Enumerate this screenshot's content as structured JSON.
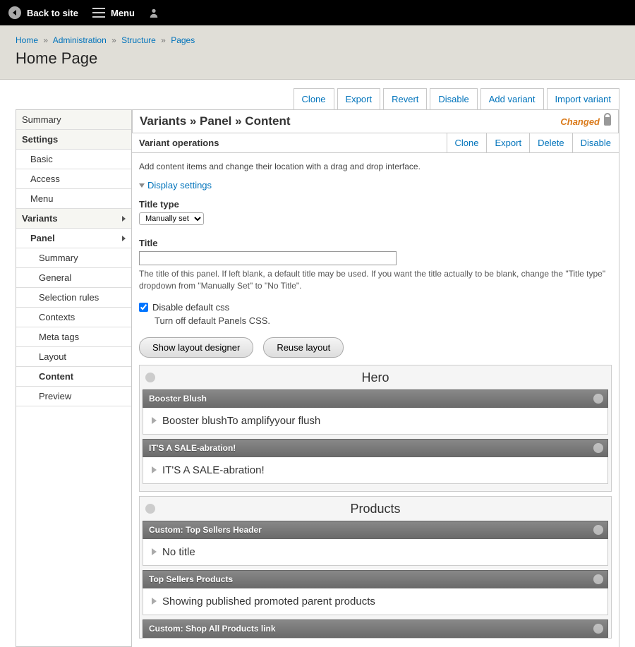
{
  "topbar": {
    "back_label": "Back to site",
    "menu_label": "Menu"
  },
  "breadcrumb": {
    "items": [
      "Home",
      "Administration",
      "Structure",
      "Pages"
    ],
    "sep": "»"
  },
  "page_title": "Home Page",
  "top_actions": [
    "Clone",
    "Export",
    "Revert",
    "Disable",
    "Add variant",
    "Import variant"
  ],
  "sidebar": {
    "summary": "Summary",
    "settings": "Settings",
    "basic": "Basic",
    "access": "Access",
    "menu": "Menu",
    "variants": "Variants",
    "panel": "Panel",
    "panel_summary": "Summary",
    "general": "General",
    "selection_rules": "Selection rules",
    "contexts": "Contexts",
    "meta_tags": "Meta tags",
    "layout": "Layout",
    "content": "Content",
    "preview": "Preview"
  },
  "right_header": {
    "crumb": "Variants » Panel » Content",
    "changed": "Changed"
  },
  "variant_ops": {
    "label": "Variant operations",
    "clone": "Clone",
    "export": "Export",
    "delete": "Delete",
    "disable": "Disable"
  },
  "body": {
    "desc": "Add content items and change their location with a drag and drop interface.",
    "display_settings": "Display settings",
    "title_type_label": "Title type",
    "title_type_value": "Manually set",
    "title_label": "Title",
    "title_value": "",
    "title_help": "The title of this panel. If left blank, a default title may be used. If you want the title actually to be blank, change the \"Title type\" dropdown from \"Manually Set\" to \"No Title\".",
    "disable_css_label": "Disable default css",
    "disable_css_checked": true,
    "disable_css_help": "Turn off default Panels CSS.",
    "show_layout_btn": "Show layout designer",
    "reuse_layout_btn": "Reuse layout"
  },
  "regions": [
    {
      "title": "Hero",
      "panes": [
        {
          "title": "Booster Blush",
          "body": "Booster blushTo amplifyyour flush"
        },
        {
          "title": "IT'S A SALE-abration!",
          "body": "IT'S A SALE-abration!"
        }
      ]
    },
    {
      "title": "Products",
      "panes": [
        {
          "title": "Custom: Top Sellers Header",
          "body": "No title"
        },
        {
          "title": "Top Sellers Products",
          "body": "Showing published promoted parent products"
        },
        {
          "title": "Custom: Shop All Products link",
          "body": ""
        }
      ]
    }
  ]
}
